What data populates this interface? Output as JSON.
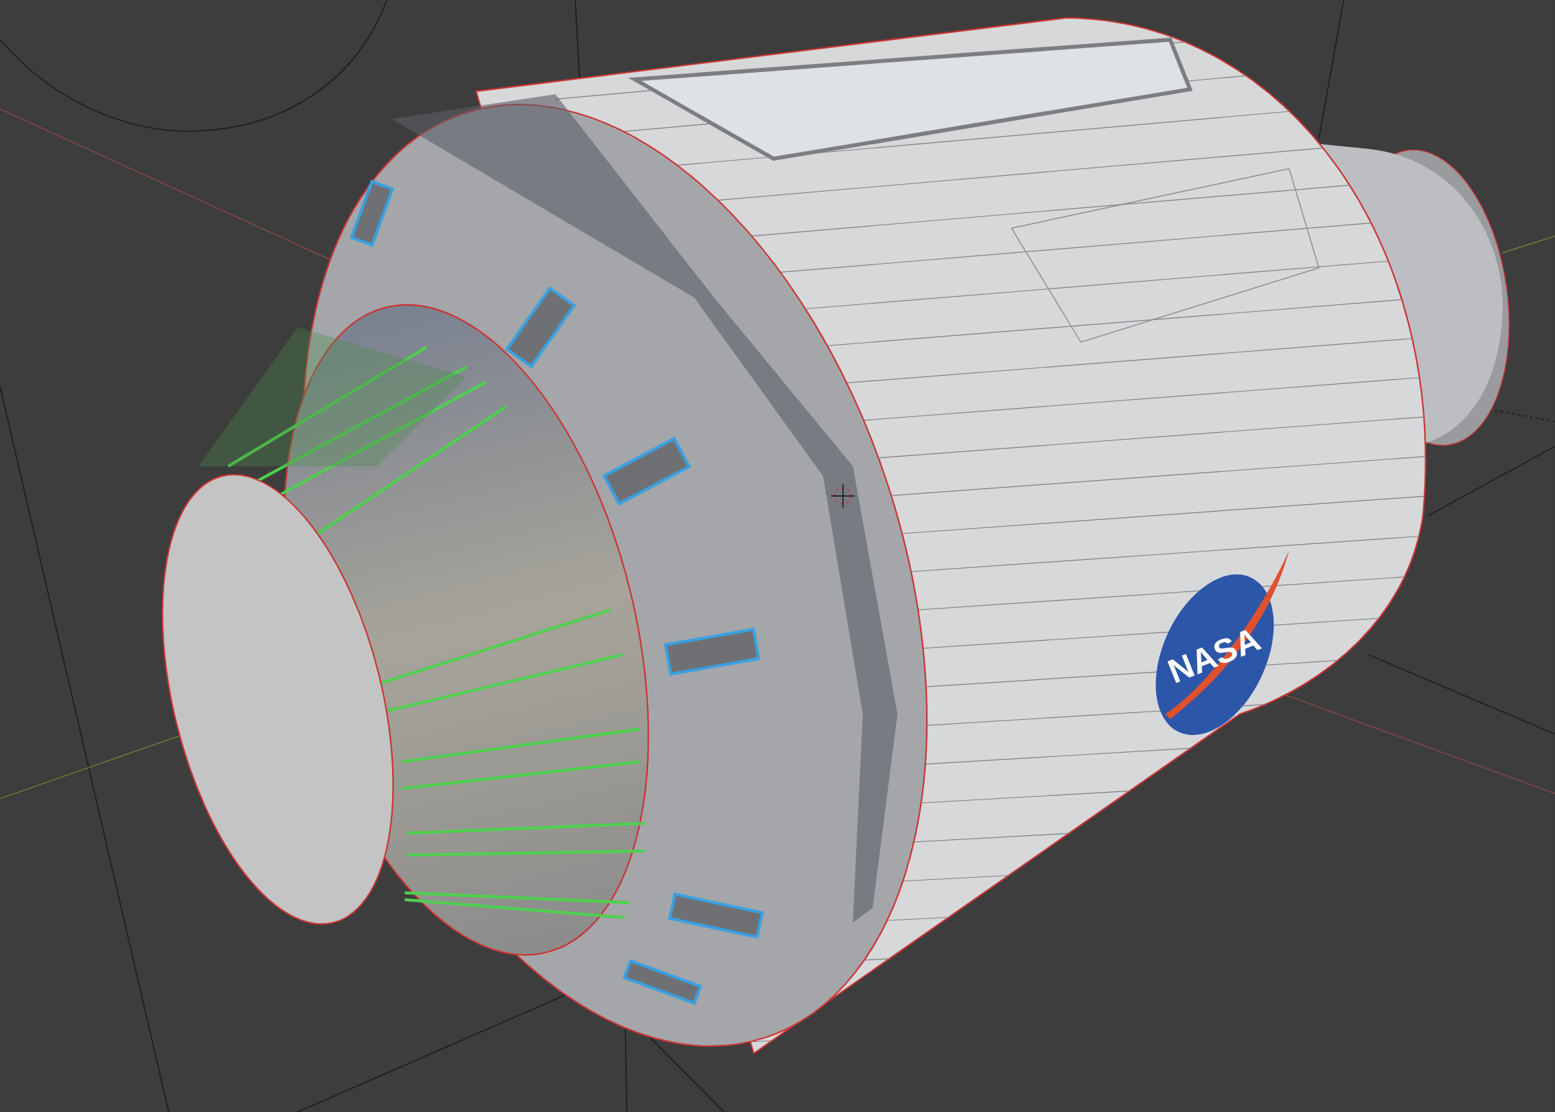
{
  "viewport": {
    "logo_text": "NASA"
  }
}
